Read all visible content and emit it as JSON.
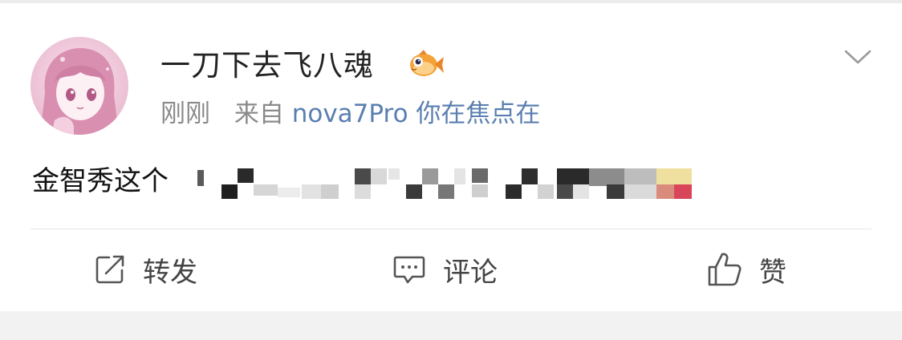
{
  "post": {
    "username": "一刀下去飞八魂",
    "time": "刚刚",
    "source_prefix": "来自",
    "device": "nova7Pro 你在焦点在",
    "text": "金智秀这个",
    "badge_icon": "fish-badge-icon",
    "more_icon": "chevron-down-icon"
  },
  "actions": {
    "repost": {
      "label": "转发",
      "icon": "share-icon"
    },
    "comment": {
      "label": "评论",
      "icon": "comment-icon"
    },
    "like": {
      "label": "赞",
      "icon": "thumbs-up-icon"
    }
  },
  "colors": {
    "text_primary": "#222222",
    "text_secondary": "#8a8a8a",
    "device_link": "#5a7fb0",
    "divider": "#e6e6e6",
    "background": "#f2f2f2"
  }
}
